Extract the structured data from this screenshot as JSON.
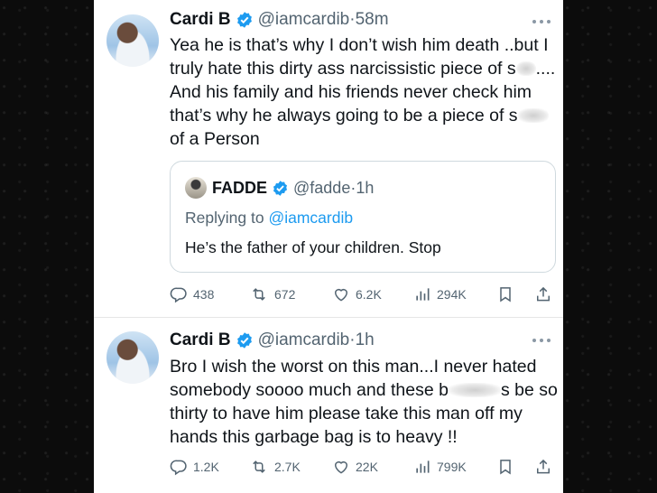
{
  "tweets": [
    {
      "author_name": "Cardi B",
      "handle": "@iamcardib",
      "separator": "·",
      "time": "58m",
      "text_parts": [
        "Yea he is that’s why I don’t wish him death ..but I truly hate this dirty ass narcissistic piece of s",
        ".... And his family and his friends never check him that’s why he always going to be a piece of s",
        "of a Person"
      ],
      "quote": {
        "author_name": "FADDE",
        "handle": "@fadde",
        "separator": "·",
        "time": "1h",
        "replying_prefix": "Replying to",
        "replying_handle": "@iamcardib",
        "text": "He’s the father of your children. Stop"
      },
      "stats": {
        "replies": "438",
        "reposts": "672",
        "likes": "6.2K",
        "views": "294K"
      }
    },
    {
      "author_name": "Cardi B",
      "handle": "@iamcardib",
      "separator": "·",
      "time": "1h",
      "text_parts": [
        "Bro I wish the worst on this man...I never hated somebody soooo much and these b",
        "s be so thirty to have him please take  this man off my hands this garbage bag  is to heavy !!"
      ],
      "stats": {
        "replies": "1.2K",
        "reposts": "2.7K",
        "likes": "22K",
        "views": "799K"
      }
    }
  ],
  "icons": [
    "verified-badge-icon",
    "more-icon",
    "reply-icon",
    "repost-icon",
    "like-icon",
    "views-icon",
    "bookmark-icon",
    "share-icon"
  ],
  "colors": {
    "verified": "#1d9bf0",
    "secondary_text": "#536471",
    "link": "#1d9bf0",
    "background_outer": "#0b0b0b"
  }
}
